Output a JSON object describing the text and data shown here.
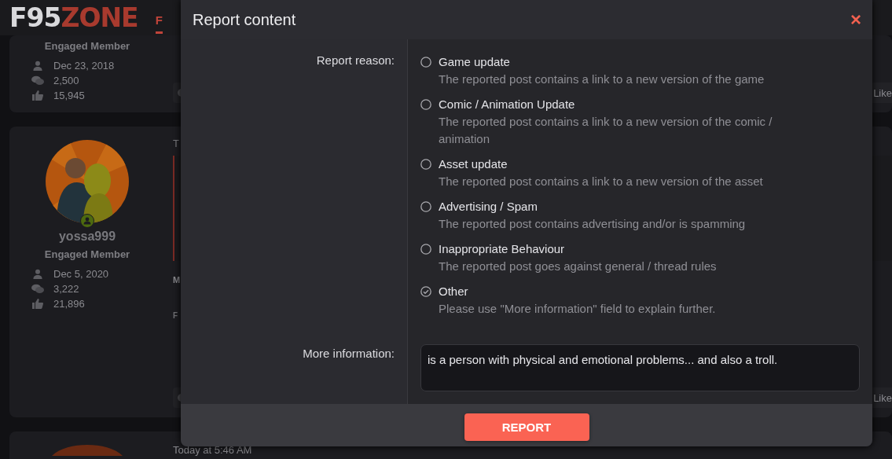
{
  "site": {
    "logo_left": "F95",
    "logo_right": "ZONE",
    "nav_item": "F"
  },
  "posts": [
    {
      "role": "Engaged Member",
      "joined": "Dec 23, 2018",
      "messages": "2,500",
      "reactions": "15,945",
      "like": "Like"
    },
    {
      "username": "yossa999",
      "online": true,
      "role": "Engaged Member",
      "joined": "Dec 5, 2020",
      "messages": "3,222",
      "reactions": "21,896",
      "text_1": "T",
      "text_2": "M",
      "text_3": "F",
      "like": "Like"
    },
    {
      "date": "Today at 5:46 AM"
    }
  ],
  "dialog": {
    "title": "Report content",
    "close": "×",
    "reason_label": "Report reason:",
    "reasons": [
      {
        "label": "Game update",
        "description": "The reported post contains a link to a new version of the game",
        "selected": false
      },
      {
        "label": "Comic / Animation Update",
        "description": "The reported post contains a link to a new version of the comic / animation",
        "selected": false
      },
      {
        "label": "Asset update",
        "description": "The reported post contains a link to a new version of the asset",
        "selected": false
      },
      {
        "label": "Advertising / Spam",
        "description": "The reported post contains advertising and/or is spamming",
        "selected": false
      },
      {
        "label": "Inappropriate Behaviour",
        "description": "The reported post goes against general / thread rules",
        "selected": false
      },
      {
        "label": "Other",
        "description": "Please use \"More information\" field to explain further.",
        "selected": true
      }
    ],
    "info_label": "More information:",
    "info_value": "is a person with physical and emotional problems... and also a troll.",
    "submit": "REPORT"
  }
}
